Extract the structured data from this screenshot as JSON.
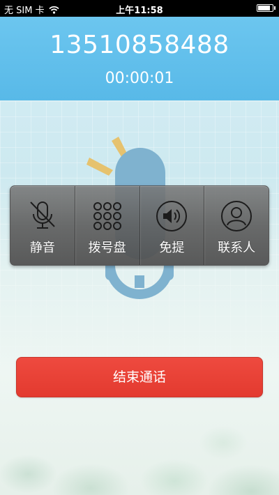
{
  "status_bar": {
    "carrier": "无 SIM 卡",
    "time": "上午11:58",
    "battery_level": 0.9
  },
  "call": {
    "phone_number": "13510858488",
    "duration": "00:00:01"
  },
  "controls": [
    {
      "label": "静音",
      "icon": "mute-icon"
    },
    {
      "label": "拨号盘",
      "icon": "dialpad-icon"
    },
    {
      "label": "免提",
      "icon": "speaker-icon"
    },
    {
      "label": "联系人",
      "icon": "contacts-icon"
    }
  ],
  "end_call": {
    "label": "结束通话",
    "color": "#e9413a"
  },
  "colors": {
    "header": "#5fbfec",
    "mic": "#7fb2cf",
    "accent_rays": "#e9c67a"
  }
}
